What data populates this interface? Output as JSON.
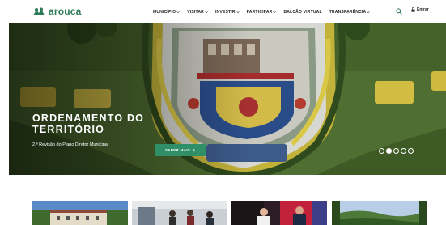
{
  "header": {
    "logo_text": "arouca",
    "brand_color": "#2f7a58",
    "nav": [
      {
        "label": "MUNICÍPIO",
        "has_dropdown": true
      },
      {
        "label": "VISITAR",
        "has_dropdown": true
      },
      {
        "label": "INVESTIR",
        "has_dropdown": true
      },
      {
        "label": "PARTICIPAR",
        "has_dropdown": true
      },
      {
        "label": "BALCÃO VIRTUAL",
        "has_dropdown": false
      },
      {
        "label": "TRANSPARÊNCIA",
        "has_dropdown": true
      }
    ],
    "search_icon": "search-icon",
    "login_label": "Entrar",
    "login_icon": "lock-icon"
  },
  "hero": {
    "title_line1": "ORDENAMENTO DO",
    "title_line2": "TERRITÓRIO",
    "subtitle": "2.ª Revisão do Plano Diretor Municipal",
    "cta_label": "SABER MAIS",
    "cta_icon": "chevron-right-icon",
    "cta_color": "#2f8f66",
    "slides_total": 5,
    "slide_active": 2
  },
  "thumbnails": [
    {
      "name": "thumb-building"
    },
    {
      "name": "thumb-meeting"
    },
    {
      "name": "thumb-people"
    },
    {
      "name": "thumb-landscape"
    }
  ]
}
